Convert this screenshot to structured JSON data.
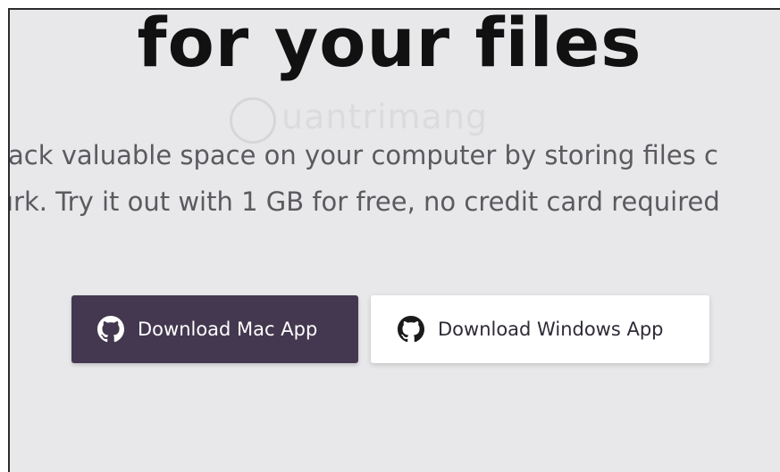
{
  "hero": {
    "headline": "for your files",
    "subline_1": "ack valuable space on your computer by storing files c",
    "subline_2": "ırk. Try it out with 1 GB for free, no credit card required"
  },
  "watermark": {
    "text": "uantrimang"
  },
  "buttons": {
    "mac_label": "Download Mac App",
    "windows_label": "Download Windows App",
    "icon": "github-icon"
  },
  "colors": {
    "background": "#e8e8ea",
    "mac_button_bg": "#43384f",
    "windows_button_bg": "#ffffff",
    "headline_text": "#111111",
    "body_text": "#5a5a5f"
  }
}
